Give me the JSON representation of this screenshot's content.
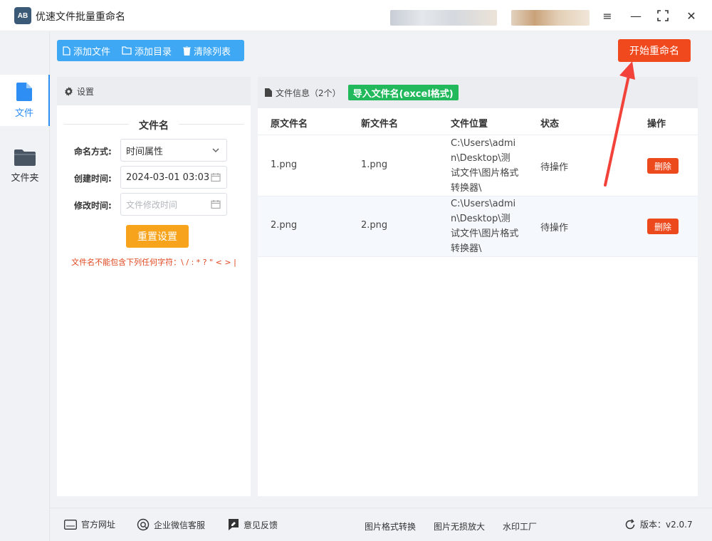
{
  "app": {
    "title": "优速文件批量重命名",
    "logo_text": "AB"
  },
  "window_controls": {
    "menu": "≡",
    "minimize": "—",
    "maximize": "⛶",
    "close": "✕"
  },
  "nav": {
    "items": [
      {
        "label": "文件",
        "icon": "file-icon",
        "active": true
      },
      {
        "label": "文件夹",
        "icon": "folder-icon",
        "active": false
      }
    ]
  },
  "toolbar": {
    "add_file": "添加文件",
    "add_dir": "添加目录",
    "clear_list": "清除列表",
    "start_rename": "开始重命名"
  },
  "settings": {
    "header": "设置",
    "section_title": "文件名",
    "naming_label": "命名方式:",
    "naming_value": "时间属性",
    "created_label": "创建时间:",
    "created_value": "2024-03-01 03:03",
    "modified_label": "修改时间:",
    "modified_placeholder": "文件修改时间",
    "reset_label": "重置设置",
    "warning": "文件名不能包含下列任何字符：\\ / : * ? \" < > |"
  },
  "file_info": {
    "header": "文件信息",
    "count": "（2个）",
    "import_label": "导入文件名(excel格式)",
    "columns": [
      "原文件名",
      "新文件名",
      "文件位置",
      "状态",
      "操作"
    ],
    "rows": [
      {
        "original": "1.png",
        "new": "1.png",
        "location": "C:\\Users\\admin\\Desktop\\测试文件\\图片格式转换器\\",
        "status": "待操作",
        "action": "删除"
      },
      {
        "original": "2.png",
        "new": "2.png",
        "location": "C:\\Users\\admin\\Desktop\\测试文件\\图片格式转换器\\",
        "status": "待操作",
        "action": "删除"
      }
    ]
  },
  "footer": {
    "website": "官方网址",
    "wechat": "企业微信客服",
    "feedback": "意见反馈",
    "format_convert": "图片格式转换",
    "lossless_zoom": "图片无损放大",
    "watermark": "水印工厂",
    "version": "版本：v2.0.7"
  },
  "colors": {
    "accent": "#3ea8f5",
    "start": "#f0491d",
    "reset": "#f7a31c",
    "import": "#21b95c",
    "delete": "#ec4a1d",
    "nav_active": "#2f8ef4"
  }
}
